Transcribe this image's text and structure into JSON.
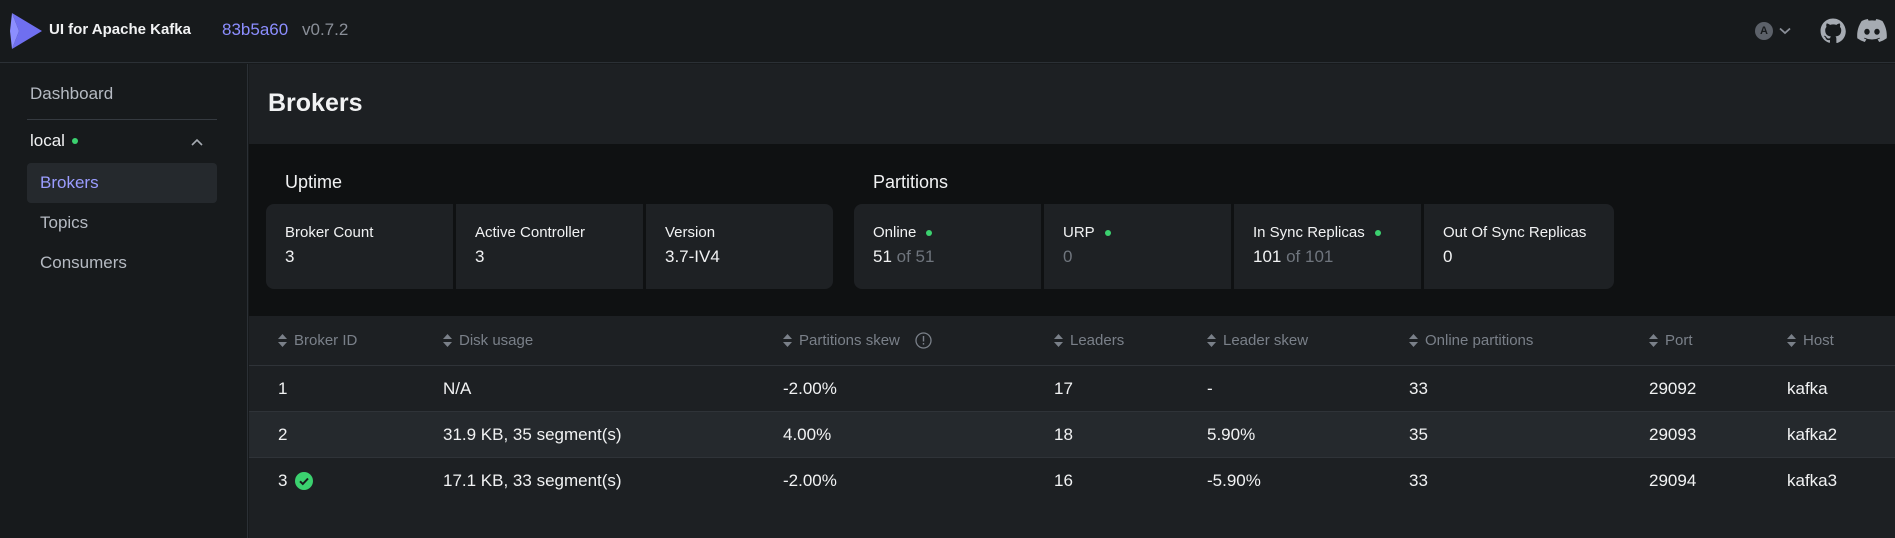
{
  "app": {
    "brand": "UI for Apache Kafka",
    "version_hash": "83b5a60",
    "version": "v0.7.2",
    "lang_badge": "A",
    "accent": "#8c8eff",
    "status_ok": "#3bd16f"
  },
  "sidebar": {
    "dashboard": "Dashboard",
    "cluster": "local",
    "items": [
      {
        "label": "Brokers",
        "active": true
      },
      {
        "label": "Topics",
        "active": false
      },
      {
        "label": "Consumers",
        "active": false
      }
    ]
  },
  "page": {
    "title": "Brokers",
    "uptime_label": "Uptime",
    "partitions_label": "Partitions"
  },
  "uptime_cards": [
    {
      "title": "Broker Count",
      "value": "3"
    },
    {
      "title": "Active Controller",
      "value": "3"
    },
    {
      "title": "Version",
      "value": "3.7-IV4"
    }
  ],
  "partition_cards": [
    {
      "title": "Online",
      "value": "51",
      "suffix": " of 51",
      "dot": true
    },
    {
      "title": "URP",
      "value": "0",
      "suffix": "",
      "dot": true,
      "muted_value": true
    },
    {
      "title": "In Sync Replicas",
      "value": "101",
      "suffix": " of 101",
      "dot": true
    },
    {
      "title": "Out Of Sync Replicas",
      "value": "0",
      "suffix": "",
      "dot": false
    }
  ],
  "table": {
    "columns": [
      "Broker ID",
      "Disk usage",
      "Partitions skew",
      "Leaders",
      "Leader skew",
      "Online partitions",
      "Port",
      "Host"
    ],
    "rows": [
      {
        "id": "1",
        "disk": "N/A",
        "pskew": "-2.00%",
        "leaders": "17",
        "lskew": "-",
        "online": "33",
        "port": "29092",
        "host": "kafka",
        "controller": false
      },
      {
        "id": "2",
        "disk": "31.9 KB, 35 segment(s)",
        "pskew": "4.00%",
        "leaders": "18",
        "lskew": "5.90%",
        "online": "35",
        "port": "29093",
        "host": "kafka2",
        "controller": false
      },
      {
        "id": "3",
        "disk": "17.1 KB, 33 segment(s)",
        "pskew": "-2.00%",
        "leaders": "16",
        "lskew": "-5.90%",
        "online": "33",
        "port": "29094",
        "host": "kafka3",
        "controller": true
      }
    ]
  }
}
